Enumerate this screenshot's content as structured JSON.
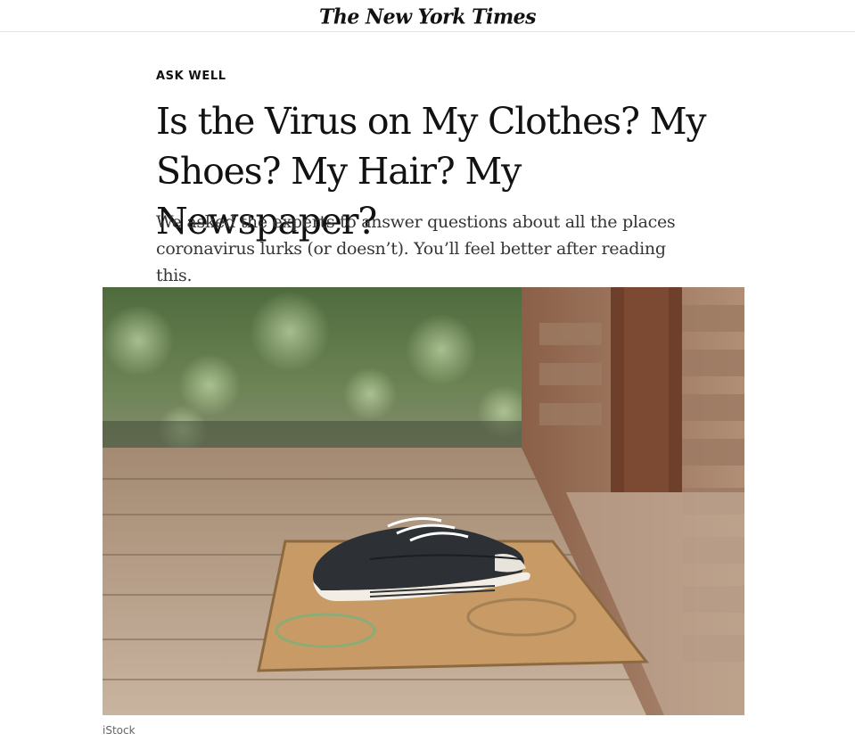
{
  "masthead": {
    "logo_text": "The New York Times"
  },
  "article": {
    "kicker": "ASK WELL",
    "headline": "Is the Virus on My Clothes? My Shoes? My Hair? My Newspaper?",
    "summary": "We asked the experts to answer questions about all the places coronavirus lurks (or doesn’t). You’ll feel better after reading this.",
    "image_credit": "iStock"
  },
  "colors": {
    "text": "#121212",
    "summary_text": "#363636",
    "credit_text": "#666666",
    "divider": "#e2e2e2"
  }
}
